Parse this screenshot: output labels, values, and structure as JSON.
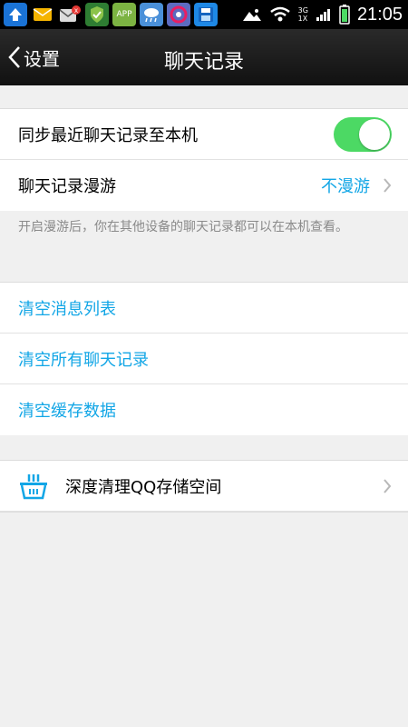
{
  "status_bar": {
    "time": "21:05",
    "network_top": "3G",
    "network_bottom": "1X",
    "app_icon_label": "APP",
    "icons": [
      "upload-icon",
      "mail-icon",
      "mail-alert-icon",
      "security-shield-icon",
      "app-store-icon",
      "weather-icon",
      "browser-icon",
      "save-icon",
      "image-icon",
      "wifi-icon",
      "signal-icon",
      "battery-icon"
    ]
  },
  "nav": {
    "back_label": "设置",
    "title": "聊天记录"
  },
  "settings": {
    "sync_label": "同步最近聊天记录至本机",
    "sync_enabled": true,
    "roaming_label": "聊天记录漫游",
    "roaming_value": "不漫游",
    "roaming_note": "开启漫游后，你在其他设备的聊天记录都可以在本机查看。"
  },
  "clear_actions": {
    "clear_messages": "清空消息列表",
    "clear_all_history": "清空所有聊天记录",
    "clear_cache": "清空缓存数据"
  },
  "deep_clean": {
    "label": "深度清理QQ存储空间"
  },
  "colors": {
    "accent_blue": "#12a6e6",
    "toggle_green": "#4cd964",
    "background": "#f0f0f0"
  }
}
